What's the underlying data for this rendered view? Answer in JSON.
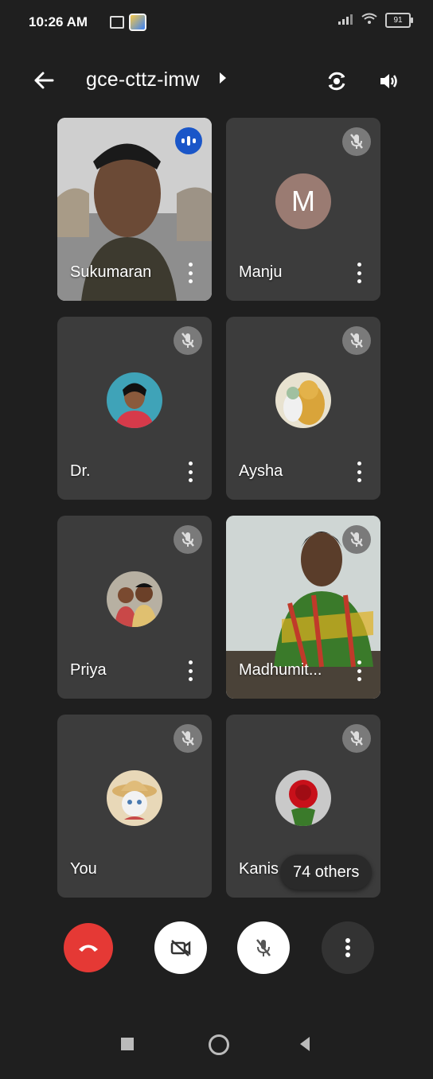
{
  "status_bar": {
    "time": "10:26 AM",
    "battery": "91"
  },
  "header": {
    "meeting_code": "gce-cttz-imw"
  },
  "participants": [
    {
      "name": "Sukumaran",
      "state": "speaking",
      "view": "video"
    },
    {
      "name": "Manju",
      "state": "muted",
      "view": "avatar",
      "initial": "M"
    },
    {
      "name": "Dr.",
      "state": "muted",
      "view": "photo"
    },
    {
      "name": "Aysha",
      "state": "muted",
      "view": "photo"
    },
    {
      "name": "Priya",
      "state": "muted",
      "view": "photo"
    },
    {
      "name": "Madhumit...",
      "state": "muted",
      "view": "video"
    },
    {
      "name": "You",
      "state": "muted",
      "view": "photo"
    },
    {
      "name": "Kanis",
      "state": "muted",
      "view": "photo"
    }
  ],
  "others_pill": "74 others",
  "colors": {
    "end_call": "#e53935",
    "speaking_badge": "#1a56c8",
    "tile_bg": "#3c3c3c",
    "avatar_m": "#9a7b72"
  }
}
